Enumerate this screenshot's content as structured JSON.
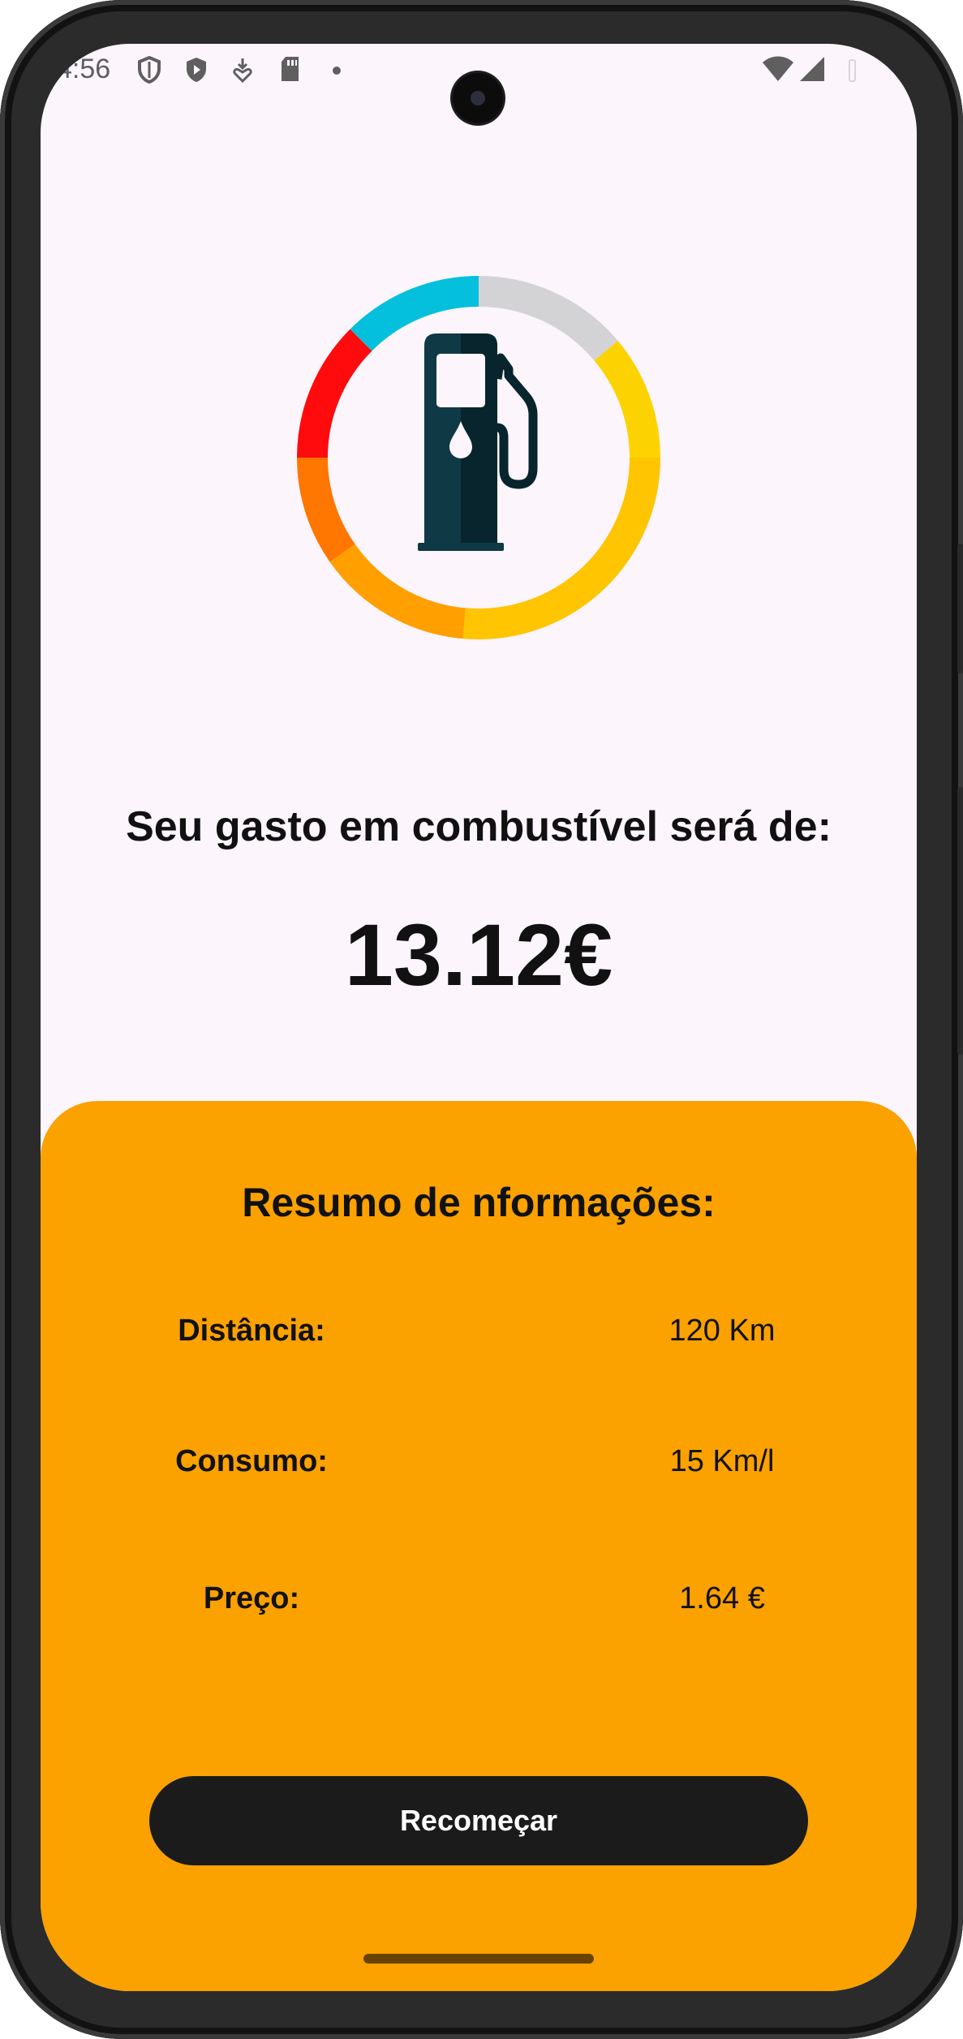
{
  "status_bar": {
    "time": "4:56",
    "icons": [
      "shield-outline-icon",
      "shield-play-icon",
      "heart-download-icon",
      "sd-card-icon",
      "dot-icon"
    ],
    "right_icons": [
      "wifi-icon",
      "cellular-signal-icon",
      "battery-icon"
    ]
  },
  "hero": {
    "icon": "fuel-pump-icon",
    "ring_colors": [
      "#d3d3d6",
      "#fcd300",
      "#fec500",
      "#ff9f00",
      "#ff7600",
      "#ff0a0d",
      "#05c0dd"
    ]
  },
  "result": {
    "headline": "Seu gasto em combustível será de:",
    "amount": "13.12€"
  },
  "summary": {
    "title": "Resumo de nformações:",
    "rows": [
      {
        "label": "Distância:",
        "value": "120 Km"
      },
      {
        "label": "Consumo:",
        "value": "15 Km/l"
      },
      {
        "label": "Preço:",
        "value": "1.64 €"
      }
    ],
    "button_label": "Recomeçar"
  },
  "colors": {
    "panel": "#fba100",
    "background": "#fcf5fc",
    "button": "#1b1b1b",
    "pump": "#0f3a45"
  }
}
